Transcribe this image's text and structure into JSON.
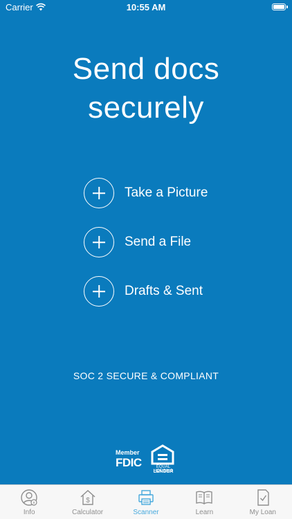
{
  "status_bar": {
    "carrier": "Carrier",
    "time": "10:55 AM"
  },
  "title": {
    "line1": "Send docs",
    "line2": "securely"
  },
  "actions": [
    {
      "label": "Take a Picture",
      "icon": "plus-circle-icon"
    },
    {
      "label": "Send a File",
      "icon": "plus-circle-icon"
    },
    {
      "label": "Drafts & Sent",
      "icon": "plus-circle-icon"
    }
  ],
  "compliance_text": "SOC 2 SECURE & COMPLIANT",
  "badges": {
    "fdic_member": "Member",
    "fdic": "FDIC",
    "ehl_small": "EQUAL HOUSING",
    "ehl_large": "LENDER"
  },
  "tabs": [
    {
      "label": "Info",
      "icon": "user-info-icon",
      "active": false
    },
    {
      "label": "Calculator",
      "icon": "house-dollar-icon",
      "active": false
    },
    {
      "label": "Scanner",
      "icon": "printer-scanner-icon",
      "active": true
    },
    {
      "label": "Learn",
      "icon": "book-icon",
      "active": false
    },
    {
      "label": "My Loan",
      "icon": "document-check-icon",
      "active": false
    }
  ],
  "colors": {
    "background": "#0a7bbd",
    "tab_active": "#46a9dd",
    "tab_inactive": "#8e8e8e"
  }
}
